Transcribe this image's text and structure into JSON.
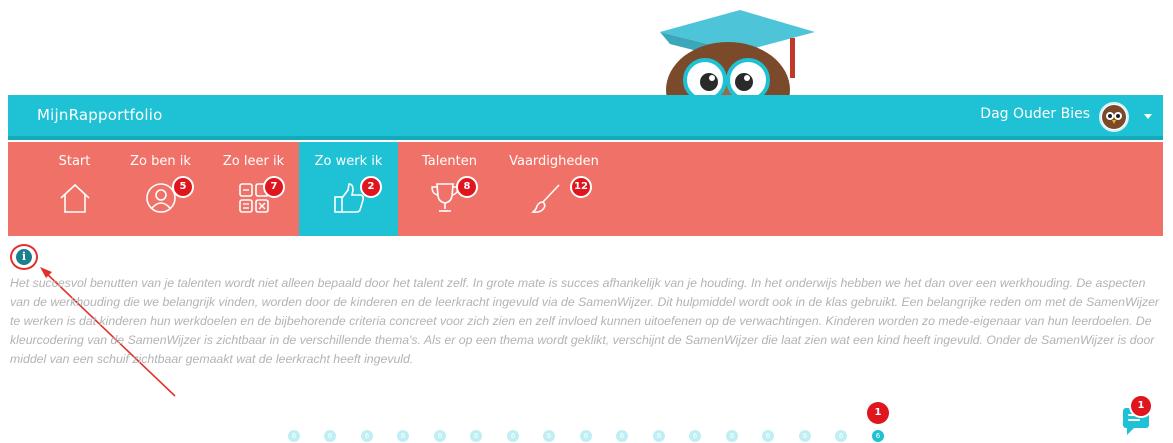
{
  "app": {
    "title": "MijnRapportfolio",
    "greeting": "Dag Ouder Bies"
  },
  "nav": {
    "items": [
      {
        "label": "Start",
        "icon": "home-icon",
        "badge": ""
      },
      {
        "label": "Zo ben ik",
        "icon": "person-icon",
        "badge": "5"
      },
      {
        "label": "Zo leer ik",
        "icon": "calculator-icon",
        "badge": "7"
      },
      {
        "label": "Zo werk ik",
        "icon": "thumbs-up-icon",
        "badge": "2"
      },
      {
        "label": "Talenten",
        "icon": "trophy-icon",
        "badge": "8"
      },
      {
        "label": "Vaardigheden",
        "icon": "brush-icon",
        "badge": "12"
      }
    ],
    "active": "Zo werk ik"
  },
  "content": {
    "info_icon_label": "i",
    "description": "Het succesvol benutten van je talenten wordt niet alleen bepaald door het talent zelf. In grote mate is succes afhankelijk van je houding. In het onderwijs hebben we het dan over een werkhouding. De aspecten van de werkhouding die we belangrijk vinden, worden door de kinderen en de leerkracht ingevuld via de SamenWijzer. Dit hulpmiddel wordt ook in de klas gebruikt. Een belangrijke reden om met de SamenWijzer te werken is dat kinderen hun werkdoelen en de bijbehorende criteria concreet voor zich zien en zelf invloed kunnen uitoefenen op de verwachtingen. Kinderen worden zo mede-eigenaar van hun leerdoelen. De kleurcodering van de SamenWijzer is zichtbaar in de verschillende thema's. Als er op een thema wordt geklikt, verschijnt de SamenWijzer die laat zien wat een kind heeft ingevuld. Onder de SamenWijzer is door middel van een schuif zichtbaar gemaakt wat de leerkracht heeft ingevuld."
  },
  "pager": {
    "dots": [
      "6",
      "6",
      "6",
      "6",
      "6",
      "6",
      "6",
      "6",
      "6",
      "6",
      "6",
      "6",
      "6",
      "6",
      "6",
      "6",
      "6"
    ],
    "alert_badge": "1"
  },
  "chat": {
    "badge": "1"
  },
  "colors": {
    "teal": "#1ec2d4",
    "coral": "#f07167",
    "badge_red": "#e0161e"
  }
}
